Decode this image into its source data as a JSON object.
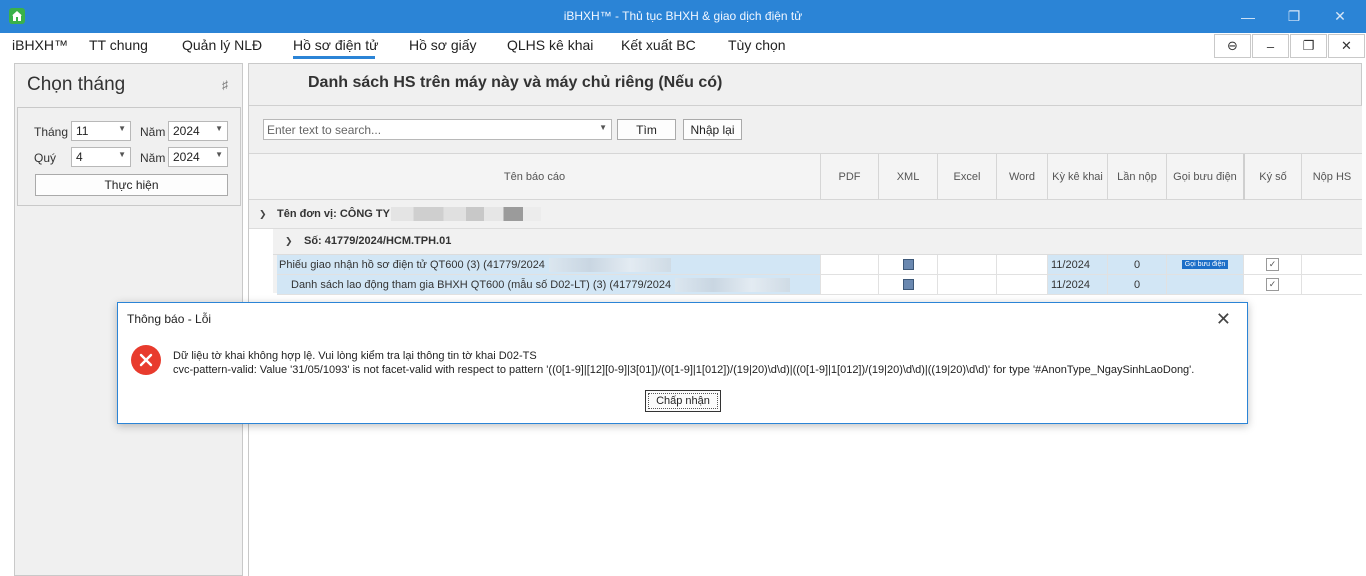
{
  "window": {
    "title": "iBHXH™ - Thủ tục BHXH & giao dịch điện tử",
    "controls": [
      "minimize-icon",
      "restore-icon",
      "close-icon"
    ]
  },
  "menu": {
    "items": [
      "iBHXH™",
      "TT chung",
      "Quản lý NLĐ",
      "Hồ sơ điện tử",
      "Hồ sơ giấy",
      "QLHS kê khai",
      "Kết xuất BC",
      "Tùy chọn"
    ],
    "active": "Hồ sơ điện tử"
  },
  "left_panel": {
    "title": "Chọn tháng",
    "thang_label": "Tháng",
    "thang_value": "11",
    "nam_label": "Năm",
    "nam_value": "2024",
    "quy_label": "Quý",
    "quy_value": "4",
    "nam2_label": "Năm",
    "nam2_value": "2024",
    "run_button": "Thực hiện"
  },
  "main": {
    "title": "Danh sách HS trên máy này và máy chủ riêng (Nếu có)",
    "search_placeholder": "Enter text to search...",
    "search_button": "Tìm",
    "reset_button": "Nhập lại",
    "columns": [
      "Tên báo cáo",
      "PDF",
      "XML",
      "Excel",
      "Word",
      "Kỳ kê khai",
      "Lần nộp",
      "Gọi bưu điện",
      "Ký số",
      "Nộp HS"
    ],
    "group_unit": "Tên đơn vị: CÔNG TY",
    "group_so": "Số: 41779/2024/HCM.TPH.01",
    "rows": [
      {
        "name": "Phiếu giao nhận hồ sơ điện tử QT600 (3) (41779/2024",
        "ky": "11/2024",
        "lan": "0",
        "post_badge": "Gọi bưu điện",
        "signed": true
      },
      {
        "name": "Danh sách lao động tham gia BHXH QT600 (mẫu số D02-LT) (3) (41779/2024",
        "ky": "11/2024",
        "lan": "0",
        "post_badge": "",
        "signed": true
      }
    ]
  },
  "dialog": {
    "title": "Thông báo - Lỗi",
    "line1": "Dữ liệu tờ khai không hợp lệ. Vui lòng kiểm tra lại thông tin tờ khai D02-TS",
    "line2": "cvc-pattern-valid: Value '31/05/1093' is not facet-valid with respect to pattern '((0[1-9]|[12][0-9]|3[01])/(0[1-9]|1[012])/(19|20)\\d\\d)|((0[1-9]|1[012])/(19|20)\\d\\d)|((19|20)\\d\\d)' for type '#AnonType_NgaySinhLaoDong'.",
    "ok_button": "Chấp nhận"
  },
  "colors": {
    "titlebar": "#2b84d6",
    "row_highlight": "#d2e6f5",
    "error_icon": "#e83b2d",
    "badge": "#1c6fc8"
  }
}
